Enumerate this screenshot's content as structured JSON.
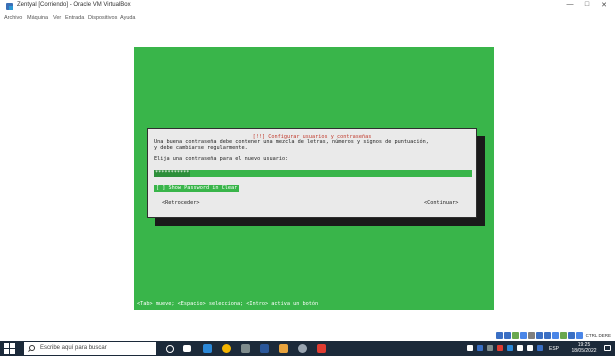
{
  "window": {
    "title": "Zentyal [Corriendo] - Oracle VM VirtualBox",
    "minimize_glyph": "—",
    "maximize_glyph": "□",
    "close_glyph": "✕"
  },
  "menu": [
    "Archivo",
    "Máquina",
    "Ver",
    "Entrada",
    "Dispositivos",
    "Ayuda"
  ],
  "installer": {
    "dialog_title": "[!!] Configurar usuarios y contraseñas",
    "line1": "Una buena contraseña debe contener una mezcla de letras, números y signos de puntuación,",
    "line2": "y debe cambiarse regularmente.",
    "prompt": "Elija una contraseña para el nuevo usuario:",
    "password_value": "***********",
    "show_password_label": "[ ] Show Password in Clear",
    "back_button": "<Retroceder>",
    "continue_button": "<Continuar>",
    "help_line": "<Tab> mueve; <Espacio> selecciona; <Intro> activa un botón"
  },
  "vbox_status": {
    "host_key_label": "CTRL DERE",
    "icon_colors": [
      "#3a6fc4",
      "#3a6fc4",
      "#6aa84f",
      "#4a86e8",
      "#7f7f7f",
      "#3a6fc4",
      "#3a6fc4",
      "#4a86e8",
      "#6aa84f",
      "#3a6fc4",
      "#4a86e8"
    ]
  },
  "taskbar": {
    "search_placeholder": "Escribe aquí para buscar",
    "language": "ESP",
    "time": "19:25",
    "date": "18/05/2022",
    "accent_color": "#1c2a3a"
  }
}
